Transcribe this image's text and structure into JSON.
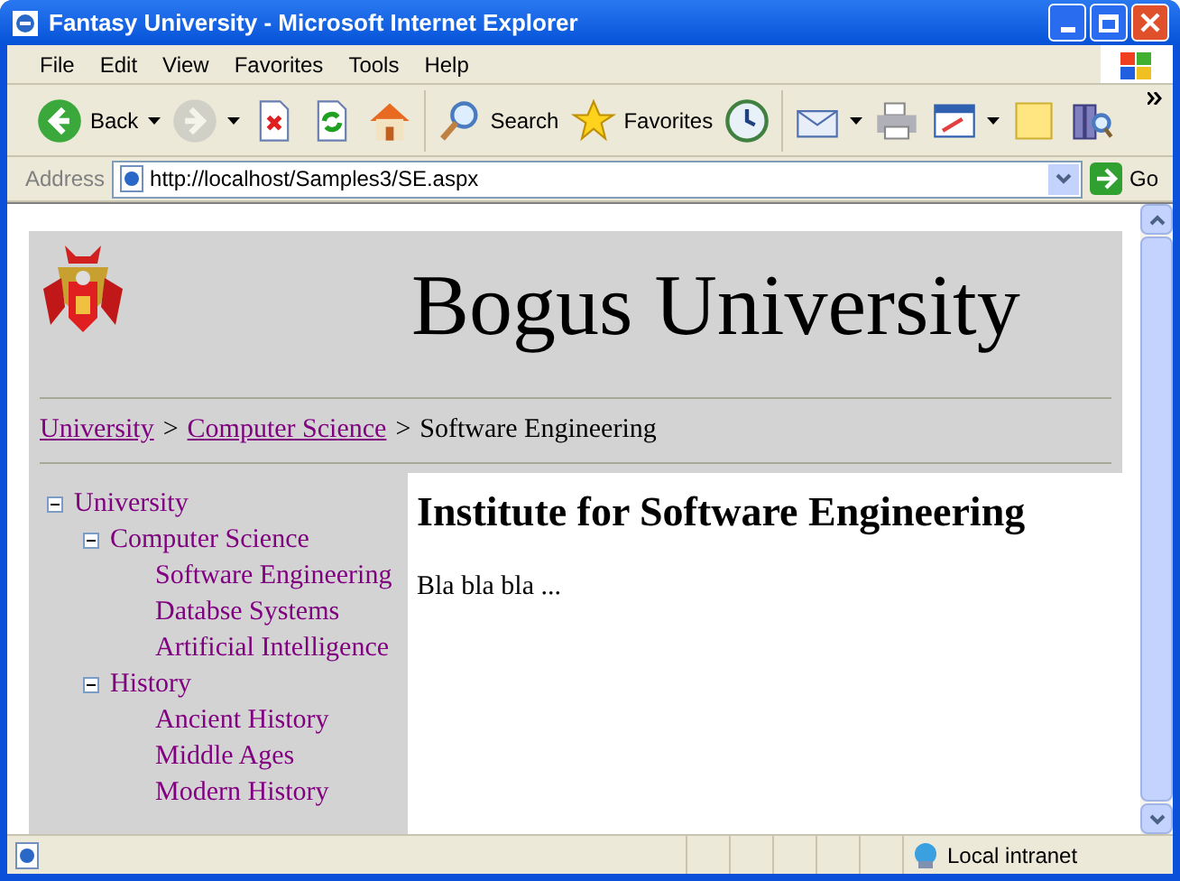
{
  "window": {
    "title": "Fantasy University - Microsoft Internet Explorer"
  },
  "menu": [
    "File",
    "Edit",
    "View",
    "Favorites",
    "Tools",
    "Help"
  ],
  "toolbar": [
    {
      "label": "Back",
      "disabled": false,
      "dropdown": true
    },
    {
      "disabled": true,
      "dropdown": true
    },
    {
      "disabled": false,
      "dropdown": false
    },
    {
      "disabled": false,
      "dropdown": false
    },
    {
      "disabled": false,
      "dropdown": false
    },
    {
      "label": "Search",
      "disabled": false,
      "dropdown": false
    },
    {
      "label": "Favorites",
      "disabled": false,
      "dropdown": false
    },
    {
      "disabled": false,
      "dropdown": false
    },
    {
      "disabled": false,
      "dropdown": true
    },
    {
      "disabled": false,
      "dropdown": false
    },
    {
      "disabled": false,
      "dropdown": true
    },
    {
      "disabled": false,
      "dropdown": false
    },
    {
      "disabled": false,
      "dropdown": false
    }
  ],
  "address": {
    "label": "Address",
    "value": "http://localhost/Samples3/SE.aspx",
    "go": "Go"
  },
  "page": {
    "title": "Bogus University",
    "breadcrumb": [
      {
        "text": "University",
        "kind": "link"
      },
      {
        "text": ">",
        "kind": "separator"
      },
      {
        "text": "Computer Science",
        "kind": "link"
      },
      {
        "text": ">",
        "kind": "separator"
      },
      {
        "text": "Software Engineering",
        "kind": "current"
      }
    ],
    "tree": [
      {
        "label": "University",
        "expanded": true,
        "children": [
          {
            "label": "Computer Science",
            "expanded": true,
            "children": [
              {
                "label": "Software Engineering"
              },
              {
                "label": "Databse Systems"
              },
              {
                "label": "Artificial Intelligence"
              }
            ]
          },
          {
            "label": "History",
            "expanded": true,
            "children": [
              {
                "label": "Ancient History"
              },
              {
                "label": "Middle Ages"
              },
              {
                "label": "Modern History"
              }
            ]
          }
        ]
      }
    ],
    "heading": "Institute for Software Engineering",
    "body": "Bla bla bla ..."
  },
  "status_bar": {
    "zone": "Local intranet"
  }
}
